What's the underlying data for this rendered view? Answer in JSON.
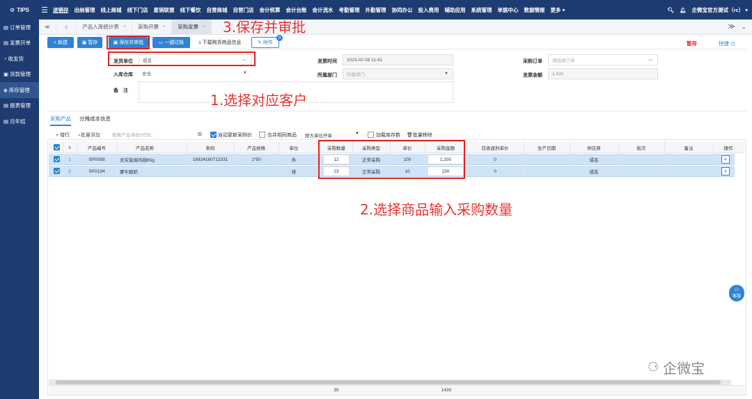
{
  "app": {
    "logo": "TIPS"
  },
  "topnav": [
    "进销存",
    "出纳管理",
    "线上商城",
    "线下门店",
    "星销联盟",
    "线下餐饮",
    "自营商城",
    "自营门店",
    "会计核算",
    "会计台账",
    "会计流水",
    "考勤管理",
    "外勤管理",
    "协同办公",
    "投入费用",
    "辅助应用",
    "系统管理",
    "单据中心",
    "数据情报",
    "更多 ▾"
  ],
  "topright": {
    "company": "企微宝官方测试（rc） ▾"
  },
  "sidebar": [
    "订单管理",
    "发票开单",
    "收发货",
    "货款管理",
    "库存管理",
    "报表管理",
    "月年结"
  ],
  "tabs": [
    "产品入库统计表",
    "采购开票",
    "采购发票"
  ],
  "toolbar": {
    "new": "+ 新建",
    "save": "暂存",
    "save_approve": "保存并审批",
    "one_key": "一键过账",
    "download": "下载购货商品信息",
    "attach": "附件",
    "attach_count": "0",
    "draft": "暂存",
    "shortcut": "快捷"
  },
  "form": {
    "supplier_label": "发货单位",
    "supplier_value": "成名",
    "warehouse_label": "入库仓库",
    "warehouse_value": "总仓",
    "remark_label": "备　注",
    "time_label": "发票时间",
    "time_value": "2023-02-08 11:41",
    "dept_label": "所属部门",
    "dept_placeholder": "所属部门",
    "order_label": "采购订单",
    "order_placeholder": "请选择订单",
    "amount_label": "发票金额",
    "amount_value": "1,430"
  },
  "subtabs": [
    "采购产品",
    "分摊成本信息"
  ],
  "gridtools": {
    "add_row": "+ 增行",
    "batch_add": "批量添加",
    "search_placeholder": "搜索产品/条码/代码...",
    "auto_update": "自动更新采购价",
    "merge": "合并相同商品",
    "unit_mode": "按大单位开单",
    "load_stock": "加载库存数",
    "batch_remove": "批量移除"
  },
  "columns": [
    "#",
    "产品编号",
    "产品名称",
    "条码",
    "产品规格",
    "单位",
    "采购数量",
    "采购类型",
    "单价",
    "采购金额",
    "应收返利单价",
    "生产日期",
    "供应商",
    "批次",
    "备注",
    "操作"
  ],
  "rows": [
    {
      "no": "1",
      "code": "SP0058",
      "name": "无穷盐焗鸡翅65g",
      "barcode": "16924160712331",
      "spec": "1*50",
      "unit": "件",
      "qty": "12",
      "type": "正常采购",
      "price": "100",
      "amount": "1,200",
      "rebate": "0",
      "date": "",
      "supplier": "成名",
      "batch": "",
      "remark": ""
    },
    {
      "no": "2",
      "code": "SP0194",
      "name": "蒙牛酸奶",
      "barcode": "",
      "spec": "",
      "unit": "排",
      "qty": "23",
      "type": "正常采购",
      "price": "10",
      "amount": "230",
      "rebate": "0",
      "date": "",
      "supplier": "成名",
      "batch": "",
      "remark": ""
    }
  ],
  "totals": {
    "qty": "35",
    "amount": "1430"
  },
  "annotations": {
    "a1": "1.选择对应客户",
    "a2": "2.选择商品输入采购数量",
    "a3": "3.保存并审批"
  },
  "watermark": "企微宝",
  "service": "客服"
}
